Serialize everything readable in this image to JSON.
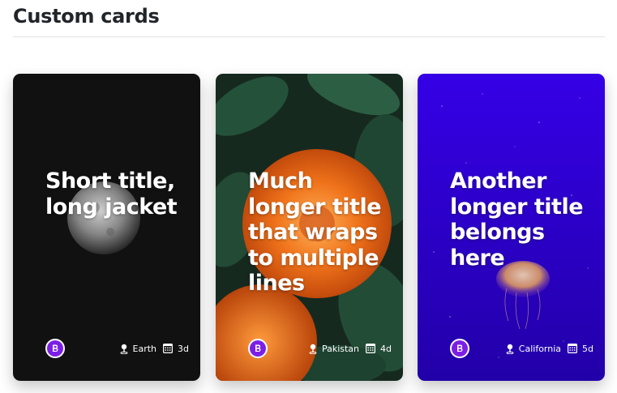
{
  "page": {
    "title": "Custom cards"
  },
  "cards": [
    {
      "title": "Short title, long jacket",
      "location": "Earth",
      "date": "3d"
    },
    {
      "title": "Much longer title that wraps to multiple lines",
      "location": "Pakistan",
      "date": "4d"
    },
    {
      "title": "Another longer title belongs here",
      "location": "California",
      "date": "5d"
    }
  ],
  "icons": {
    "avatar": "bootstrap-logo-icon",
    "location": "geo-pin-icon",
    "date": "calendar-icon"
  },
  "colors": {
    "card1_bg": "#111111",
    "card2_bg": "#1a3a2b",
    "card3_bg": "#3a00e0",
    "avatar_bg": "#7c1fe6"
  }
}
